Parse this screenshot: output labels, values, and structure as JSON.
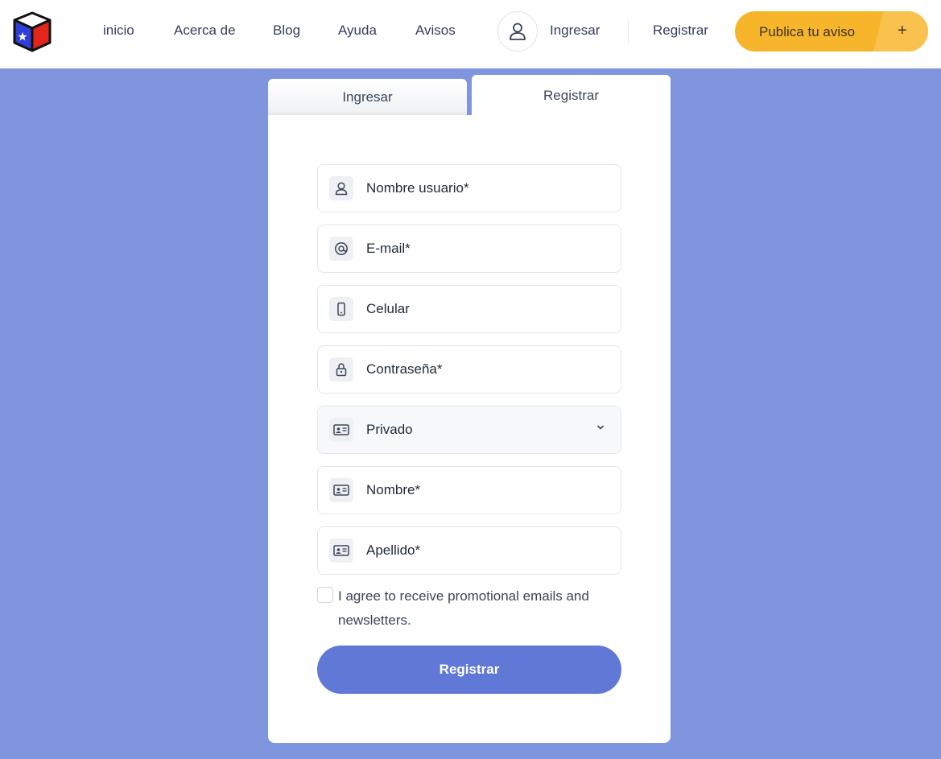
{
  "colors": {
    "page_background": "#7f96df",
    "header_background": "#ffffff",
    "publish_button": "#f7b52c",
    "submit_button": "#6078d6"
  },
  "header": {
    "nav": [
      "inicio",
      "Acerca de",
      "Blog",
      "Ayuda",
      "Avisos"
    ],
    "login_link": "Ingresar",
    "register_link": "Registrar",
    "publish_button": "Publica tu aviso",
    "publish_icon": "+"
  },
  "tabs": {
    "login": "Ingresar",
    "register": "Registrar",
    "active": "register"
  },
  "form": {
    "fields": [
      {
        "icon": "user-icon",
        "placeholder": "Nombre usuario*"
      },
      {
        "icon": "at-sign-icon",
        "placeholder": "E-mail*"
      },
      {
        "icon": "phone-icon",
        "placeholder": "Celular"
      },
      {
        "icon": "lock-icon",
        "placeholder": "Contraseña*"
      },
      {
        "icon": "id-card-icon",
        "selected": "Privado"
      },
      {
        "icon": "id-card-icon",
        "placeholder": "Nombre*"
      },
      {
        "icon": "id-card-icon",
        "placeholder": "Apellido*"
      }
    ],
    "newsletter_label": "I agree to receive promotional emails and newsletters.",
    "newsletter_checked": false,
    "submit_label": "Registrar"
  }
}
